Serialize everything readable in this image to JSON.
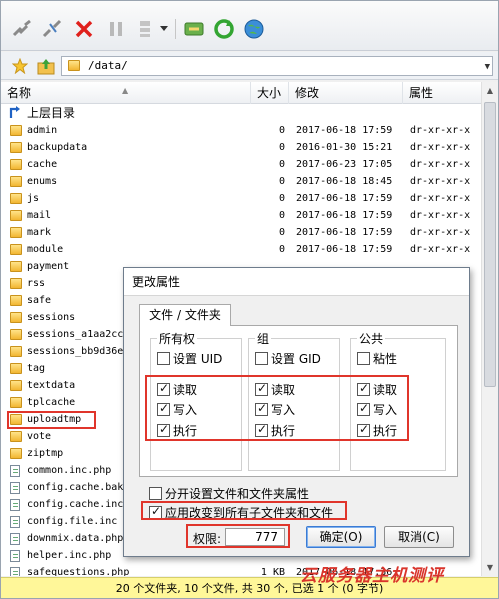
{
  "address": {
    "path": "/data/"
  },
  "columns": {
    "name": "名称",
    "size": "大小",
    "modified": "修改",
    "attributes": "属性"
  },
  "parent_label": "上层目录",
  "files": [
    {
      "name": "admin",
      "type": "folder",
      "size": "0",
      "modified": "2017-06-18 17:59",
      "attr": "dr-xr-xr-x"
    },
    {
      "name": "backupdata",
      "type": "folder",
      "size": "0",
      "modified": "2016-01-30 15:21",
      "attr": "dr-xr-xr-x"
    },
    {
      "name": "cache",
      "type": "folder",
      "size": "0",
      "modified": "2017-06-23 17:05",
      "attr": "dr-xr-xr-x"
    },
    {
      "name": "enums",
      "type": "folder",
      "size": "0",
      "modified": "2017-06-18 18:45",
      "attr": "dr-xr-xr-x"
    },
    {
      "name": "js",
      "type": "folder",
      "size": "0",
      "modified": "2017-06-18 17:59",
      "attr": "dr-xr-xr-x"
    },
    {
      "name": "mail",
      "type": "folder",
      "size": "0",
      "modified": "2017-06-18 17:59",
      "attr": "dr-xr-xr-x"
    },
    {
      "name": "mark",
      "type": "folder",
      "size": "0",
      "modified": "2017-06-18 17:59",
      "attr": "dr-xr-xr-x"
    },
    {
      "name": "module",
      "type": "folder",
      "size": "0",
      "modified": "2017-06-18 17:59",
      "attr": "dr-xr-xr-x"
    },
    {
      "name": "payment",
      "type": "folder",
      "size": "",
      "modified": "",
      "attr": ""
    },
    {
      "name": "rss",
      "type": "folder",
      "size": "",
      "modified": "",
      "attr": ""
    },
    {
      "name": "safe",
      "type": "folder",
      "size": "",
      "modified": "",
      "attr": ""
    },
    {
      "name": "sessions",
      "type": "folder",
      "size": "",
      "modified": "",
      "attr": ""
    },
    {
      "name": "sessions_a1aa2cc",
      "type": "folder",
      "size": "",
      "modified": "",
      "attr": ""
    },
    {
      "name": "sessions_bb9d36e",
      "type": "folder",
      "size": "",
      "modified": "",
      "attr": ""
    },
    {
      "name": "tag",
      "type": "folder",
      "size": "",
      "modified": "",
      "attr": ""
    },
    {
      "name": "textdata",
      "type": "folder",
      "size": "",
      "modified": "",
      "attr": ""
    },
    {
      "name": "tplcache",
      "type": "folder",
      "size": "",
      "modified": "",
      "attr": ""
    },
    {
      "name": "uploadtmp",
      "type": "folder",
      "size": "",
      "modified": "",
      "attr": ""
    },
    {
      "name": "vote",
      "type": "folder",
      "size": "",
      "modified": "",
      "attr": ""
    },
    {
      "name": "ziptmp",
      "type": "folder",
      "size": "",
      "modified": "",
      "attr": ""
    },
    {
      "name": "common.inc.php",
      "type": "file",
      "size": "",
      "modified": "",
      "attr": ""
    },
    {
      "name": "config.cache.bak",
      "type": "file",
      "size": "",
      "modified": "",
      "attr": ""
    },
    {
      "name": "config.cache.inc",
      "type": "file",
      "size": "",
      "modified": "",
      "attr": ""
    },
    {
      "name": "config.file.inc",
      "type": "file",
      "size": "",
      "modified": "",
      "attr": ""
    },
    {
      "name": "downmix.data.php",
      "type": "file",
      "size": "",
      "modified": "",
      "attr": ""
    },
    {
      "name": "helper.inc.php",
      "type": "file",
      "size": "",
      "modified": "",
      "attr": ""
    },
    {
      "name": "safequestions.php",
      "type": "file",
      "size": "1 KB",
      "modified": "2017-06-18 17:36",
      "attr": ""
    }
  ],
  "status": "20 个文件夹, 10 个文件, 共 30 个, 已选 1 个 (0 字节)",
  "watermark": "云服务器主机测评",
  "dialog": {
    "title": "更改属性",
    "tab": "文件 / 文件夹",
    "groups": [
      {
        "label": "所有权",
        "special": "设置 UID",
        "special_checked": false
      },
      {
        "label": "组",
        "special": "设置 GID",
        "special_checked": false
      },
      {
        "label": "公共",
        "special": "粘性",
        "special_checked": false
      }
    ],
    "perm_labels": {
      "read": "读取",
      "write": "写入",
      "exec": "执行"
    },
    "separate_label": "分开设置文件和文件夹属性",
    "separate_checked": false,
    "apply_label": "应用改变到所有子文件夹和文件",
    "apply_checked": true,
    "perm_field_label": "权限:",
    "perm_value": "777",
    "ok_label": "确定(O)",
    "cancel_label": "取消(C)"
  },
  "colors": {
    "highlight": "#e0352b",
    "status_bg": "#fff799"
  }
}
